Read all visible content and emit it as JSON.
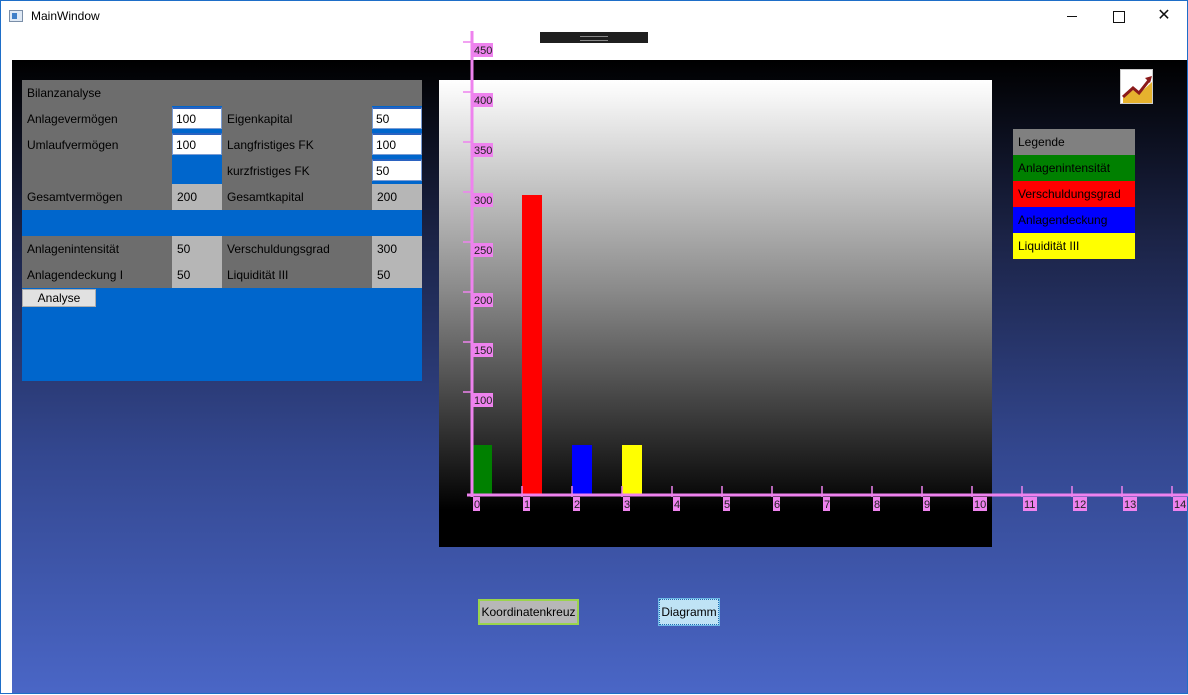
{
  "window": {
    "title": "MainWindow",
    "icon": "window-icon"
  },
  "panel": {
    "heading": "Bilanzanalyse",
    "anlagevermoegen_label": "Anlagevermögen",
    "anlagevermoegen_value": "100",
    "eigenkapital_label": "Eigenkapital",
    "eigenkapital_value": "50",
    "umlaufvermoegen_label": "Umlaufvermögen",
    "umlaufvermoegen_value": "100",
    "langfristiges_label": "Langfristiges FK",
    "langfristiges_value": "100",
    "kurzfristiges_label": "kurzfristiges FK",
    "kurzfristiges_value": "50",
    "gesamtvermoegen_label": "Gesamtvermögen",
    "gesamtvermoegen_value": "200",
    "gesamtkapital_label": "Gesamtkapital",
    "gesamtkapital_value": "200",
    "anlagenintensitaet_label": "Anlagenintensität",
    "anlagenintensitaet_value": "50",
    "verschuldungsgrad_label": "Verschuldungsgrad",
    "verschuldungsgrad_value": "300",
    "anlagendeckung_label": "Anlagendeckung I",
    "anlagendeckung_value": "50",
    "liquiditaet_label": "Liquidität III",
    "liquiditaet_value": "50",
    "analyse_button": "Analyse"
  },
  "legend": {
    "title": "Legende",
    "items": [
      {
        "label": "Anlagenintensität",
        "color": "#008000"
      },
      {
        "label": "Verschuldungsgrad",
        "color": "#ff0000"
      },
      {
        "label": "Anlagendeckung",
        "color": "#0000ff"
      },
      {
        "label": "Liquidität III",
        "color": "#ffff00"
      }
    ]
  },
  "buttons": {
    "koordinatenkreuz": "Koordinatenkreuz",
    "diagramm": "Diagramm"
  },
  "chart_data": {
    "type": "bar",
    "x_ticks": [
      "0",
      "1",
      "2",
      "3",
      "4",
      "5",
      "6",
      "7",
      "8",
      "9",
      "10",
      "11",
      "12",
      "13",
      "14"
    ],
    "y_ticks": [
      "100",
      "150",
      "200",
      "250",
      "300",
      "350",
      "400",
      "450"
    ],
    "bars": [
      {
        "x": 0,
        "value": 50,
        "color": "#008000"
      },
      {
        "x": 1,
        "value": 300,
        "color": "#ff0000"
      },
      {
        "x": 2,
        "value": 50,
        "color": "#0000ff"
      },
      {
        "x": 3,
        "value": 50,
        "color": "#ffff00"
      }
    ],
    "ylim": [
      0,
      450
    ],
    "axis_color": "#ee82ee"
  }
}
